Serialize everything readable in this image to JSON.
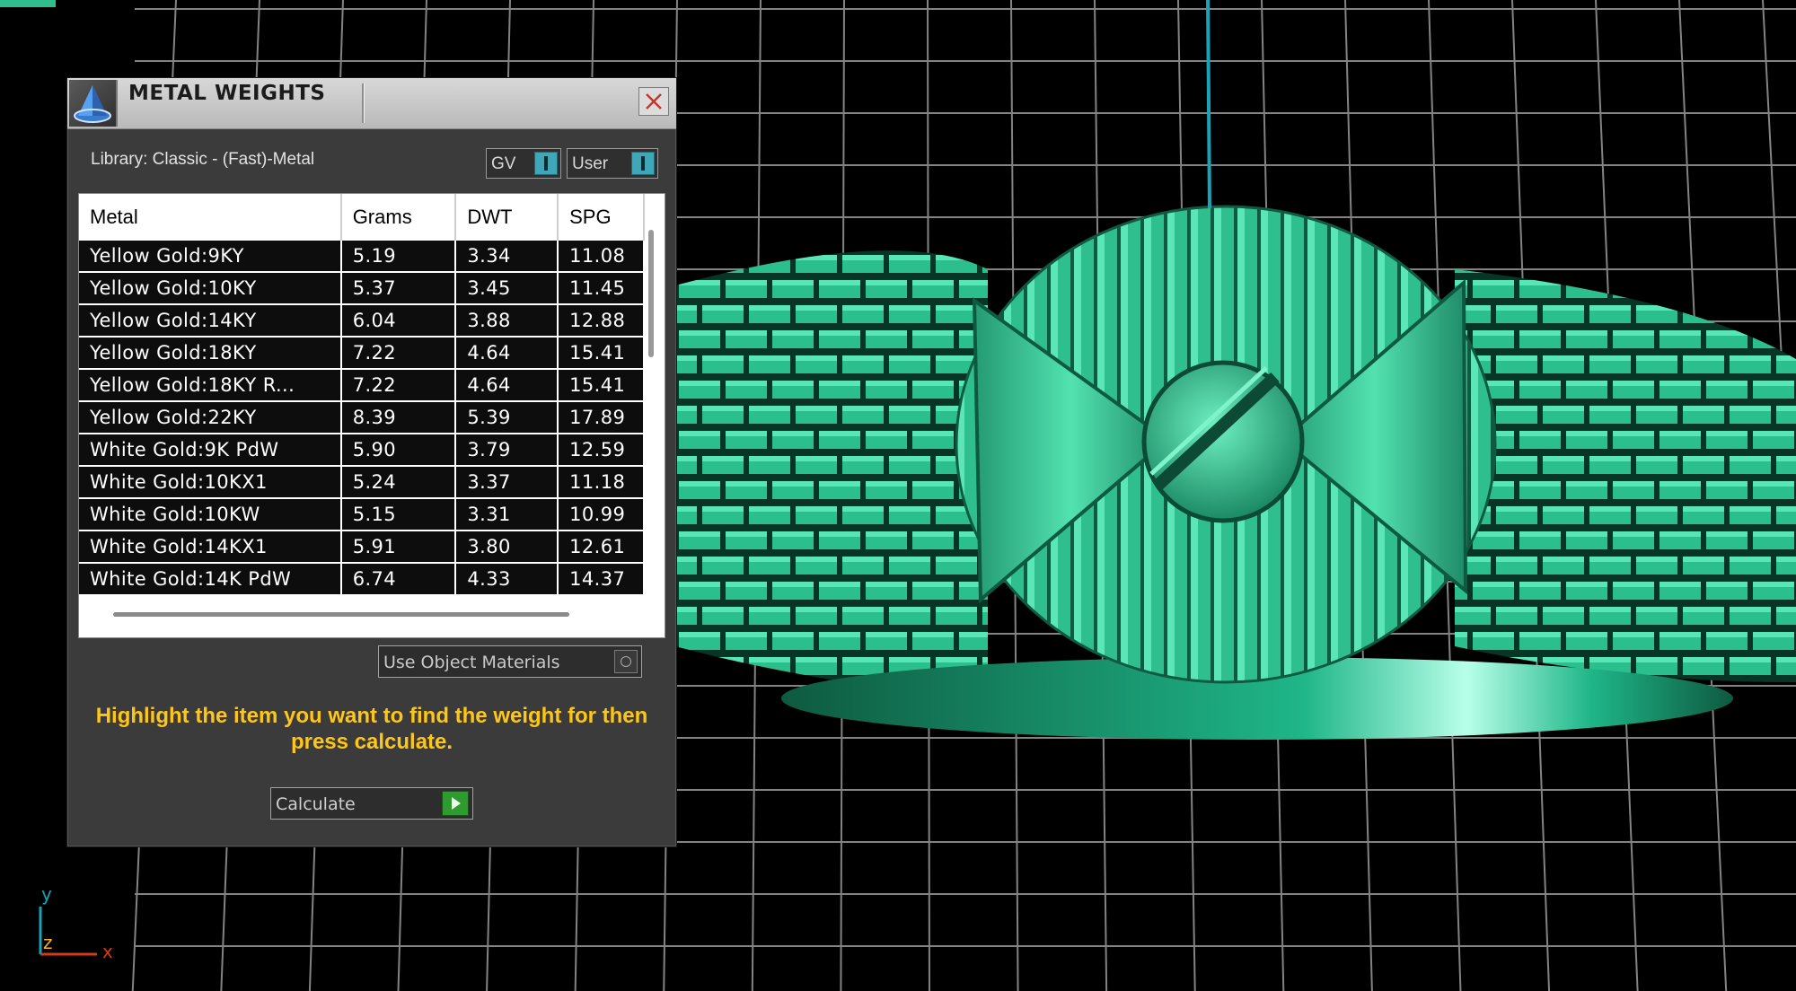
{
  "panel": {
    "title": "METAL WEIGHTS",
    "library_label": "Library: Classic - (Fast)-Metal",
    "toggles": [
      {
        "label": "GV"
      },
      {
        "label": "User"
      }
    ],
    "table": {
      "columns": [
        "Metal",
        "Grams",
        "DWT",
        "SPG"
      ],
      "rows": [
        [
          "Yellow Gold:9KY",
          "5.19",
          "3.34",
          "11.08"
        ],
        [
          "Yellow Gold:10KY",
          "5.37",
          "3.45",
          "11.45"
        ],
        [
          "Yellow Gold:14KY",
          "6.04",
          "3.88",
          "12.88"
        ],
        [
          "Yellow Gold:18KY",
          "7.22",
          "4.64",
          "15.41"
        ],
        [
          "Yellow Gold:18KY R...",
          "7.22",
          "4.64",
          "15.41"
        ],
        [
          "Yellow Gold:22KY",
          "8.39",
          "5.39",
          "17.89"
        ],
        [
          "White Gold:9K PdW",
          "5.90",
          "3.79",
          "12.59"
        ],
        [
          "White Gold:10KX1",
          "5.24",
          "3.37",
          "11.18"
        ],
        [
          "White Gold:10KW",
          "5.15",
          "3.31",
          "10.99"
        ],
        [
          "White Gold:14KX1",
          "5.91",
          "3.80",
          "12.61"
        ],
        [
          "White Gold:14K PdW",
          "6.74",
          "4.33",
          "14.37"
        ]
      ]
    },
    "use_object_materials_label": "Use Object Materials",
    "hint": "Highlight the item you want to find the weight for then press calculate.",
    "calculate_label": "Calculate"
  },
  "axes": {
    "y": "y",
    "z": "z",
    "x": "x"
  },
  "colors": {
    "model_green": "#2fbf8f",
    "grid": "#9a9a9a",
    "hint_yellow": "#ffc61a",
    "axis_line": "#1aa3b8"
  }
}
